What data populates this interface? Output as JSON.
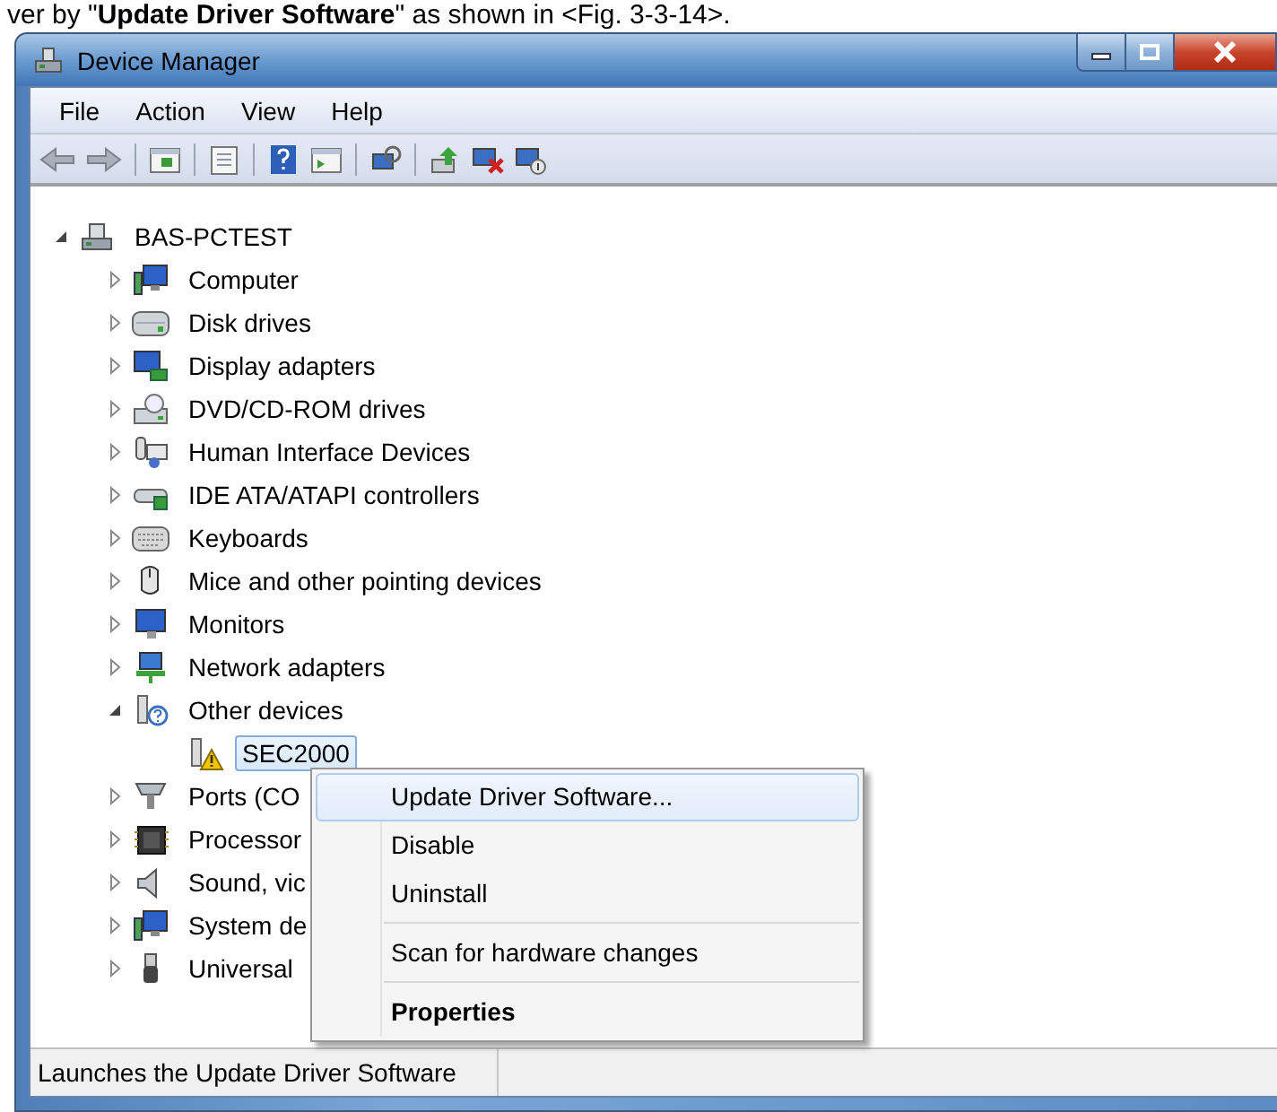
{
  "caption": "ver by \"**Update Driver Software**\" as shown in <Fig. 3-3-14>.",
  "window": {
    "title": "Device Manager"
  },
  "menu_bar": [
    "File",
    "Action",
    "View",
    "Help"
  ],
  "tree": {
    "label": "BAS-PCTEST",
    "kind": "host",
    "expanded": true,
    "selected": false,
    "children": [
      {
        "label": "Computer",
        "kind": "computer",
        "expanded": false,
        "selected": false
      },
      {
        "label": "Disk drives",
        "kind": "disk",
        "expanded": false,
        "selected": false
      },
      {
        "label": "Display adapters",
        "kind": "display",
        "expanded": false,
        "selected": false
      },
      {
        "label": "DVD/CD-ROM drives",
        "kind": "dvd",
        "expanded": false,
        "selected": false
      },
      {
        "label": "Human Interface Devices",
        "kind": "hid",
        "expanded": false,
        "selected": false
      },
      {
        "label": "IDE ATA/ATAPI controllers",
        "kind": "ide",
        "expanded": false,
        "selected": false
      },
      {
        "label": "Keyboards",
        "kind": "keyboard",
        "expanded": false,
        "selected": false
      },
      {
        "label": "Mice and other pointing devices",
        "kind": "mouse",
        "expanded": false,
        "selected": false
      },
      {
        "label": "Monitors",
        "kind": "monitor",
        "expanded": false,
        "selected": false
      },
      {
        "label": "Network adapters",
        "kind": "network",
        "expanded": false,
        "selected": false
      },
      {
        "label": "Other devices",
        "kind": "other",
        "expanded": true,
        "selected": false,
        "children": [
          {
            "label": "SEC2000",
            "kind": "warning",
            "selected": true
          }
        ]
      },
      {
        "label": "Ports (CO",
        "kind": "ports",
        "expanded": false,
        "selected": false
      },
      {
        "label": "Processor",
        "kind": "processor",
        "expanded": false,
        "selected": false
      },
      {
        "label": "Sound, vic",
        "kind": "sound",
        "expanded": false,
        "selected": false
      },
      {
        "label": "System de",
        "kind": "computer",
        "expanded": false,
        "selected": false
      },
      {
        "label": "Universal",
        "kind": "usb",
        "expanded": false,
        "selected": false
      }
    ]
  },
  "context_menu": [
    {
      "kind": "item",
      "label": "Update Driver Software...",
      "selected": true,
      "default": false
    },
    {
      "kind": "item",
      "label": "Disable",
      "selected": false,
      "default": false
    },
    {
      "kind": "item",
      "label": "Uninstall",
      "selected": false,
      "default": false
    },
    {
      "kind": "separator"
    },
    {
      "kind": "item",
      "label": "Scan for hardware changes",
      "selected": false,
      "default": false
    },
    {
      "kind": "separator"
    },
    {
      "kind": "item",
      "label": "Properties",
      "selected": false,
      "default": true
    }
  ],
  "status_bar": {
    "text": "Launches the Update Driver Software"
  }
}
